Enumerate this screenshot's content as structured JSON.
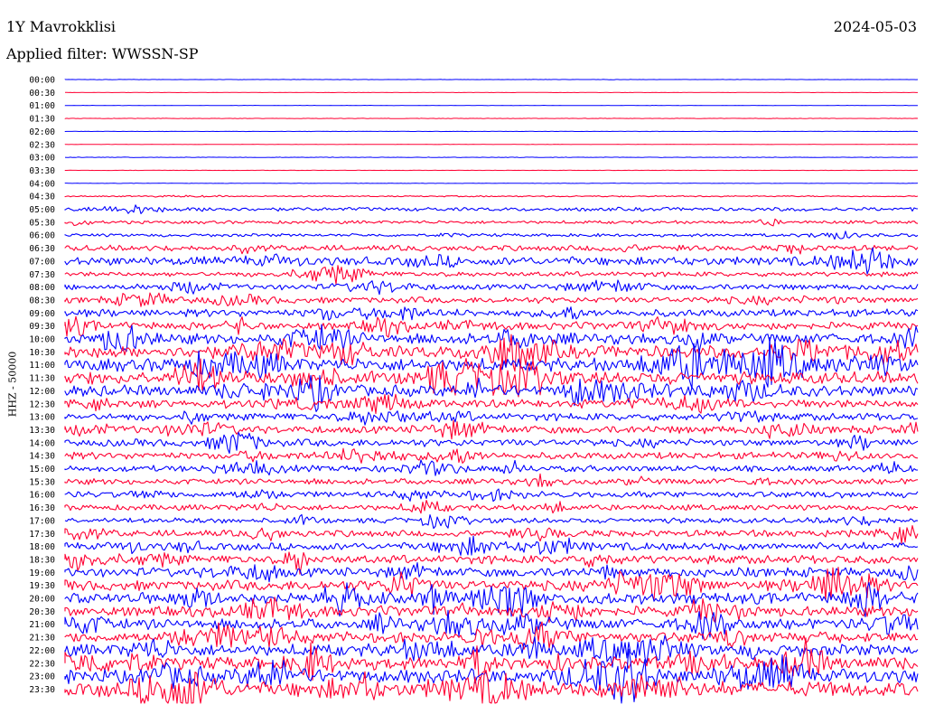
{
  "header": {
    "station": "1Y Mavrokklisi",
    "date": "2024-05-03",
    "filter": "Applied filter: WWSSN-SP"
  },
  "colors": {
    "trace_a": "#0000ff",
    "trace_b": "#ff0033"
  },
  "chart_data": {
    "type": "line",
    "title": "1Y Mavrokklisi",
    "ylabel": "HHZ - 50000",
    "xlabel": "",
    "grid": false,
    "legend": "none",
    "row_interval": "30 min",
    "color_alternation": [
      "blue",
      "red"
    ],
    "rows": [
      {
        "label": "00:00",
        "amplitude": 0.03
      },
      {
        "label": "00:30",
        "amplitude": 0.03
      },
      {
        "label": "01:00",
        "amplitude": 0.03
      },
      {
        "label": "01:30",
        "amplitude": 0.04
      },
      {
        "label": "02:00",
        "amplitude": 0.03
      },
      {
        "label": "02:30",
        "amplitude": 0.03
      },
      {
        "label": "03:00",
        "amplitude": 0.05
      },
      {
        "label": "03:30",
        "amplitude": 0.03
      },
      {
        "label": "04:00",
        "amplitude": 0.04
      },
      {
        "label": "04:30",
        "amplitude": 0.12
      },
      {
        "label": "05:00",
        "amplitude": 0.35
      },
      {
        "label": "05:30",
        "amplitude": 0.3
      },
      {
        "label": "06:00",
        "amplitude": 0.3
      },
      {
        "label": "06:30",
        "amplitude": 0.55
      },
      {
        "label": "07:00",
        "amplitude": 0.85
      },
      {
        "label": "07:30",
        "amplitude": 0.45
      },
      {
        "label": "08:00",
        "amplitude": 0.55
      },
      {
        "label": "08:30",
        "amplitude": 0.6
      },
      {
        "label": "09:00",
        "amplitude": 0.7
      },
      {
        "label": "09:30",
        "amplitude": 0.75
      },
      {
        "label": "10:00",
        "amplitude": 1.0
      },
      {
        "label": "10:30",
        "amplitude": 1.2
      },
      {
        "label": "11:00",
        "amplitude": 1.25
      },
      {
        "label": "11:30",
        "amplitude": 1.2
      },
      {
        "label": "12:00",
        "amplitude": 1.1
      },
      {
        "label": "12:30",
        "amplitude": 0.8
      },
      {
        "label": "13:00",
        "amplitude": 0.7
      },
      {
        "label": "13:30",
        "amplitude": 0.75
      },
      {
        "label": "14:00",
        "amplitude": 0.7
      },
      {
        "label": "14:30",
        "amplitude": 0.65
      },
      {
        "label": "15:00",
        "amplitude": 0.6
      },
      {
        "label": "15:30",
        "amplitude": 0.55
      },
      {
        "label": "16:00",
        "amplitude": 0.6
      },
      {
        "label": "16:30",
        "amplitude": 0.55
      },
      {
        "label": "17:00",
        "amplitude": 0.5
      },
      {
        "label": "17:30",
        "amplitude": 0.65
      },
      {
        "label": "18:00",
        "amplitude": 0.75
      },
      {
        "label": "18:30",
        "amplitude": 0.8
      },
      {
        "label": "19:00",
        "amplitude": 0.9
      },
      {
        "label": "19:30",
        "amplitude": 1.0
      },
      {
        "label": "20:00",
        "amplitude": 1.1
      },
      {
        "label": "20:30",
        "amplitude": 1.0
      },
      {
        "label": "21:00",
        "amplitude": 1.0
      },
      {
        "label": "21:30",
        "amplitude": 1.05
      },
      {
        "label": "22:00",
        "amplitude": 1.15
      },
      {
        "label": "22:30",
        "amplitude": 1.25
      },
      {
        "label": "23:00",
        "amplitude": 1.35
      },
      {
        "label": "23:30",
        "amplitude": 1.4
      }
    ]
  }
}
